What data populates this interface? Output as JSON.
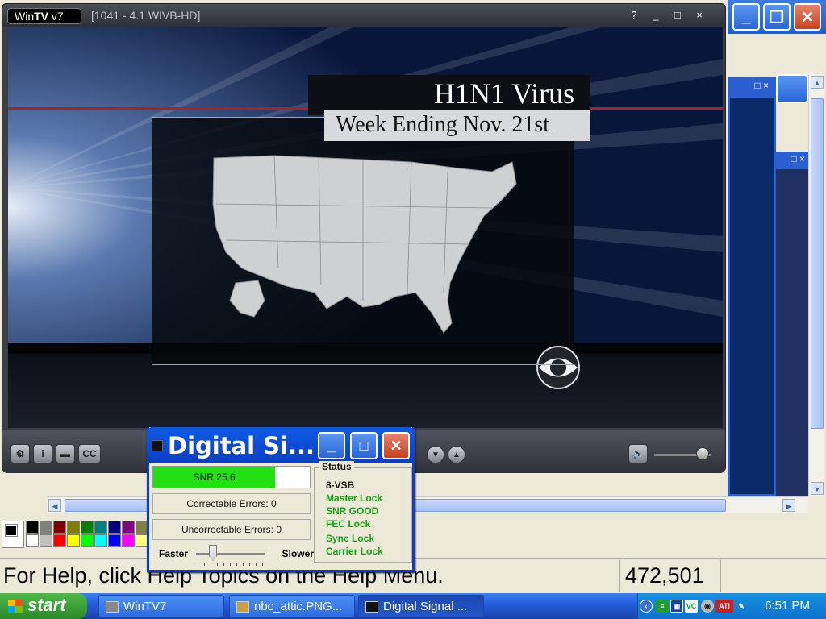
{
  "wintv": {
    "logo_prefix": "Win",
    "logo_bold": "TV",
    "logo_suffix": " v7",
    "channel": "[1041 - 4.1   WIVB-HD]",
    "window_controls": "? _ □ ×",
    "video": {
      "headline": "H1N1 Virus",
      "subheadline": "Week Ending Nov. 21st"
    },
    "controls": {
      "settings_icon": "gear-icon",
      "info_label": "i",
      "folder_icon": "folder-icon",
      "cc_label": "CC",
      "channel_down": "▼",
      "channel_up": "▲"
    },
    "volume_level": 0.85
  },
  "background_window": {
    "status_help": "For Help, click Help Topics on the Help Menu.",
    "coordinates": "472,501",
    "palette_colors": [
      "#000000",
      "#808080",
      "#800000",
      "#808000",
      "#008000",
      "#008080",
      "#000080",
      "#800080",
      "#808040",
      "#ffffff",
      "#c0c0c0",
      "#ff0000",
      "#ffff00",
      "#00ff00",
      "#00ffff",
      "#0000ff",
      "#ff00ff",
      "#ffff80"
    ]
  },
  "digital_signal": {
    "title": "Digital Si...",
    "snr_label": "SNR 25.6",
    "snr_fill_fraction": 0.78,
    "correctable_errors": "Correctable Errors:  0",
    "uncorrectable_errors": "Uncorrectable Errors:  0",
    "speed_faster": "Faster",
    "speed_slower": "Slower",
    "status_title": "Status",
    "status_items": [
      {
        "text": "8-VSB",
        "color": "#111111"
      },
      {
        "text": "Master Lock",
        "color": "#16a012"
      },
      {
        "text": "SNR GOOD",
        "color": "#16a012"
      },
      {
        "text": "FEC Lock",
        "color": "#16a012"
      },
      {
        "text": "Sync Lock",
        "color": "#16a012"
      },
      {
        "text": "Carrier Lock",
        "color": "#16a012"
      }
    ]
  },
  "taskbar": {
    "start": "start",
    "tasks": [
      {
        "label": "WinTV7",
        "active": false
      },
      {
        "label": "nbc_attic.PNG...",
        "active": false
      },
      {
        "label": "Digital Signal ...",
        "active": true
      }
    ],
    "clock": "6:51 PM",
    "tray_ati": "ATI"
  }
}
